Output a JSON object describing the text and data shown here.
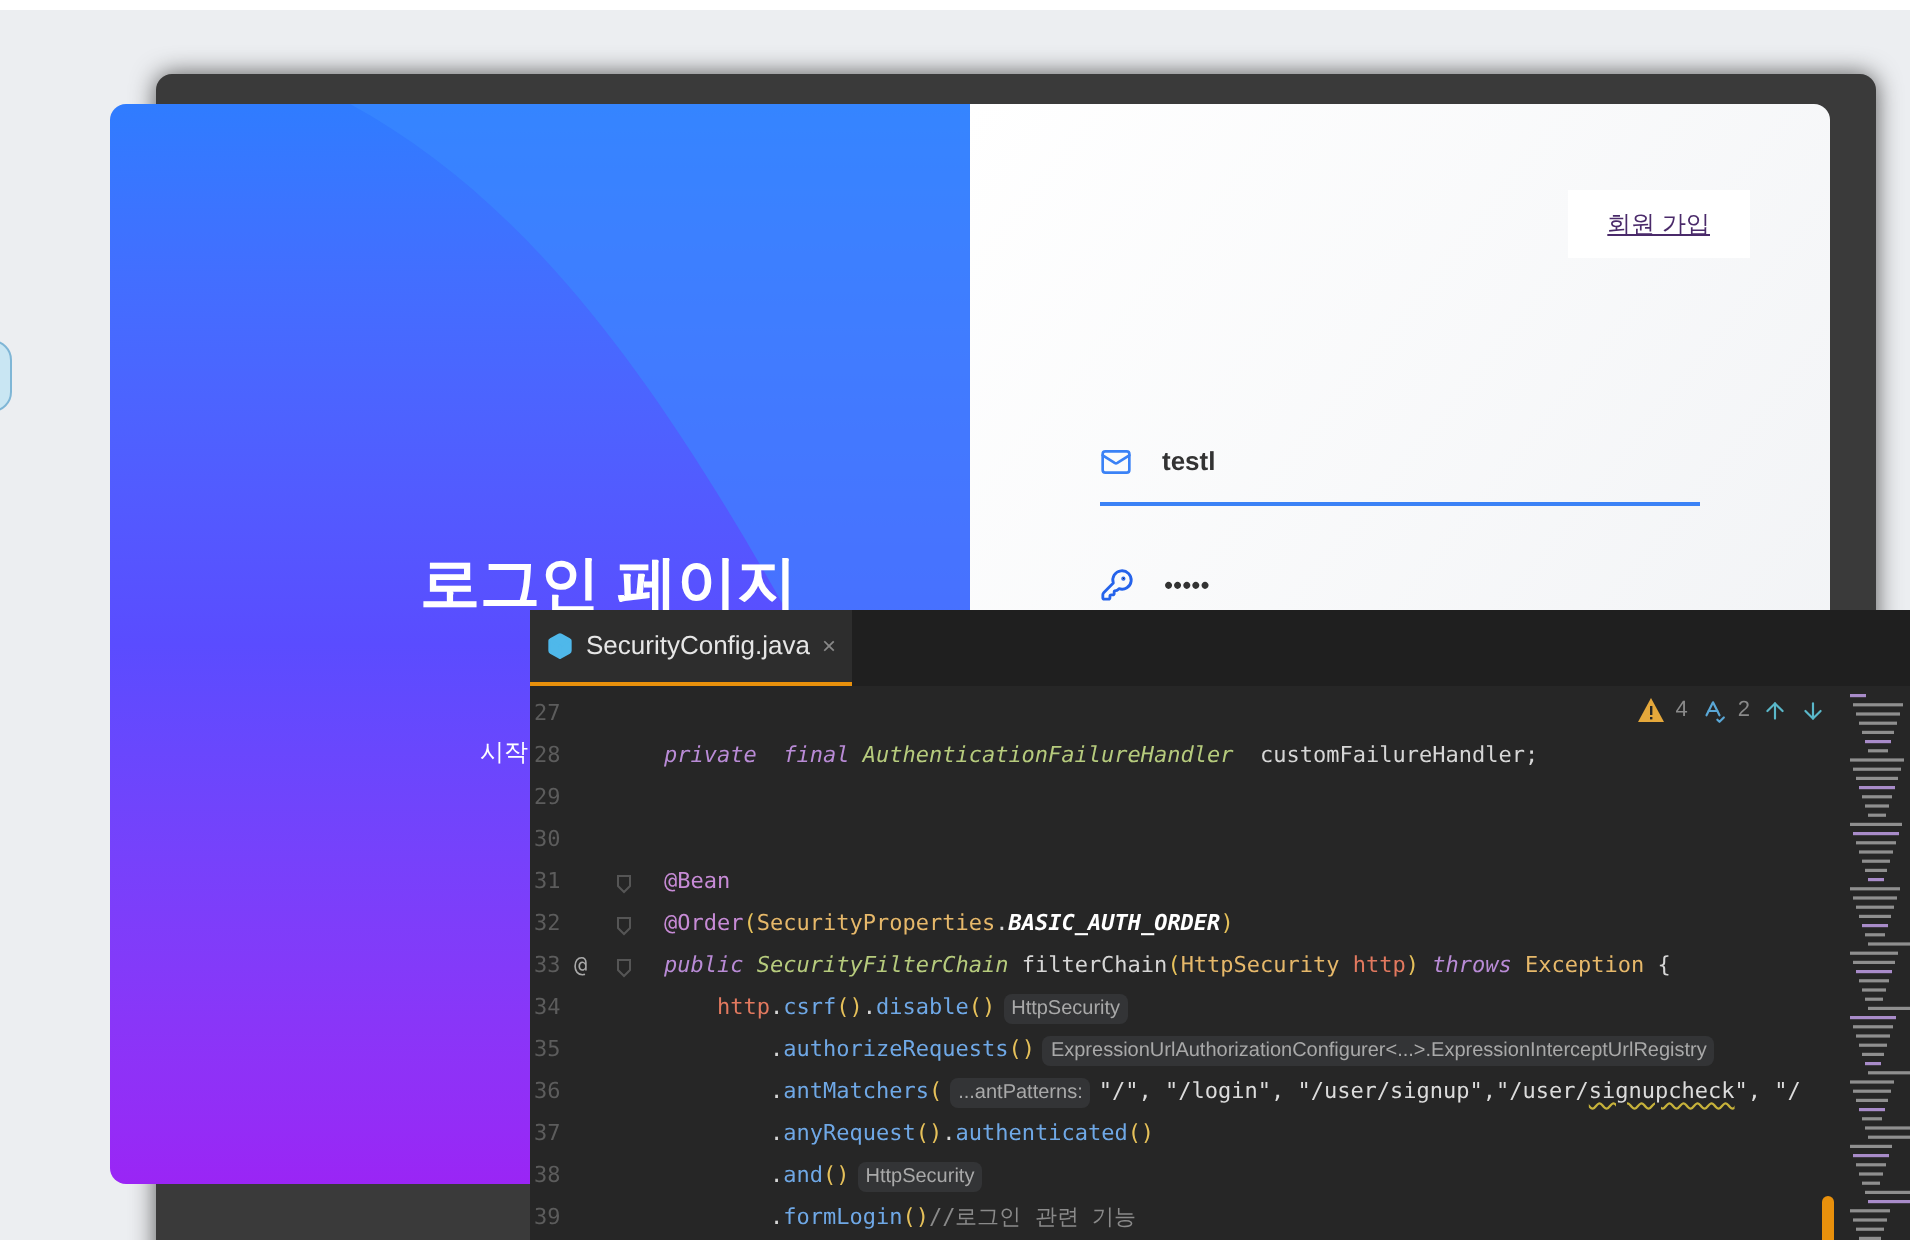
{
  "login": {
    "title": "로그인 페이지",
    "subtitle": "시작",
    "signup_link": "회원 가입",
    "email": {
      "value": "testl"
    },
    "password": {
      "value": "•••••"
    }
  },
  "editor": {
    "tabs": [
      {
        "label": "SecurityConfig.java",
        "close": "×",
        "selected": true
      }
    ],
    "inspections": {
      "warnings": "4",
      "typos": "2"
    },
    "lines": [
      {
        "number": "27",
        "fold": false
      },
      {
        "number": "28",
        "fold": false,
        "segments": [
          {
            "kind": "kw",
            "text": "private"
          },
          {
            "kind": "kw",
            "text": "  final"
          },
          {
            "kind": "type",
            "text": " AuthenticationFailureHandler"
          },
          {
            "kind": "plain",
            "text": "  customFailureHandler;"
          }
        ]
      },
      {
        "number": "29",
        "fold": false
      },
      {
        "number": "30",
        "fold": false
      },
      {
        "number": "31",
        "fold": true,
        "segments": [
          {
            "kind": "ann",
            "text": "@Bean"
          }
        ]
      },
      {
        "number": "32",
        "fold": true,
        "segments": [
          {
            "kind": "ann",
            "text": "@Order"
          },
          {
            "kind": "paren",
            "text": "("
          },
          {
            "kind": "cls",
            "text": "SecurityProperties"
          },
          {
            "kind": "plain",
            "text": "."
          },
          {
            "kind": "const",
            "text": "BASIC_AUTH_ORDER"
          },
          {
            "kind": "paren",
            "text": ")"
          }
        ]
      },
      {
        "number": "33",
        "fold": true,
        "mark": "@",
        "segments": [
          {
            "kind": "kw",
            "text": "public"
          },
          {
            "kind": "type",
            "text": " SecurityFilterChain"
          },
          {
            "kind": "plain",
            "text": " filterChain"
          },
          {
            "kind": "paren",
            "text": "("
          },
          {
            "kind": "cls",
            "text": "HttpSecurity"
          },
          {
            "kind": "param",
            "text": " http"
          },
          {
            "kind": "paren",
            "text": ")"
          },
          {
            "kind": "kw",
            "text": " throws"
          },
          {
            "kind": "cls",
            "text": " Exception"
          },
          {
            "kind": "plain",
            "text": " {"
          }
        ]
      },
      {
        "number": "34",
        "fold": false,
        "segments": [
          {
            "kind": "param",
            "text": "    http"
          },
          {
            "kind": "plain",
            "text": "."
          },
          {
            "kind": "method",
            "text": "csrf"
          },
          {
            "kind": "paren",
            "text": "()"
          },
          {
            "kind": "plain",
            "text": "."
          },
          {
            "kind": "method",
            "text": "disable"
          },
          {
            "kind": "paren",
            "text": "()"
          },
          {
            "kind": "hint",
            "text": "HttpSecurity"
          }
        ]
      },
      {
        "number": "35",
        "fold": false,
        "segments": [
          {
            "kind": "plain",
            "text": "        ."
          },
          {
            "kind": "method",
            "text": "authorizeRequests"
          },
          {
            "kind": "paren",
            "text": "()"
          },
          {
            "kind": "hint",
            "text": "ExpressionUrlAuthorizationConfigurer<...>.ExpressionInterceptUrlRegistry"
          }
        ]
      },
      {
        "number": "36",
        "fold": false,
        "segments": [
          {
            "kind": "plain",
            "text": "        ."
          },
          {
            "kind": "method",
            "text": "antMatchers"
          },
          {
            "kind": "paren",
            "text": "("
          },
          {
            "kind": "hint",
            "text": "...antPatterns:"
          },
          {
            "kind": "str",
            "text": "\"/\", \"/login\", \"/user/signup\",\"/user/"
          },
          {
            "kind": "typo",
            "text": "signupcheck"
          },
          {
            "kind": "str",
            "text": "\", \"/"
          }
        ]
      },
      {
        "number": "37",
        "fold": false,
        "segments": [
          {
            "kind": "plain",
            "text": "        ."
          },
          {
            "kind": "method",
            "text": "anyRequest"
          },
          {
            "kind": "paren",
            "text": "()"
          },
          {
            "kind": "plain",
            "text": "."
          },
          {
            "kind": "method",
            "text": "authenticated"
          },
          {
            "kind": "paren",
            "text": "()"
          }
        ]
      },
      {
        "number": "38",
        "fold": false,
        "segments": [
          {
            "kind": "plain",
            "text": "        ."
          },
          {
            "kind": "method",
            "text": "and"
          },
          {
            "kind": "paren",
            "text": "()"
          },
          {
            "kind": "hint",
            "text": "HttpSecurity"
          }
        ]
      },
      {
        "number": "39",
        "fold": false,
        "segments": [
          {
            "kind": "plain",
            "text": "        ."
          },
          {
            "kind": "method",
            "text": "formLogin"
          },
          {
            "kind": "paren",
            "text": "()"
          },
          {
            "kind": "comment",
            "text": "//로그인 관련 기능"
          }
        ]
      }
    ]
  }
}
